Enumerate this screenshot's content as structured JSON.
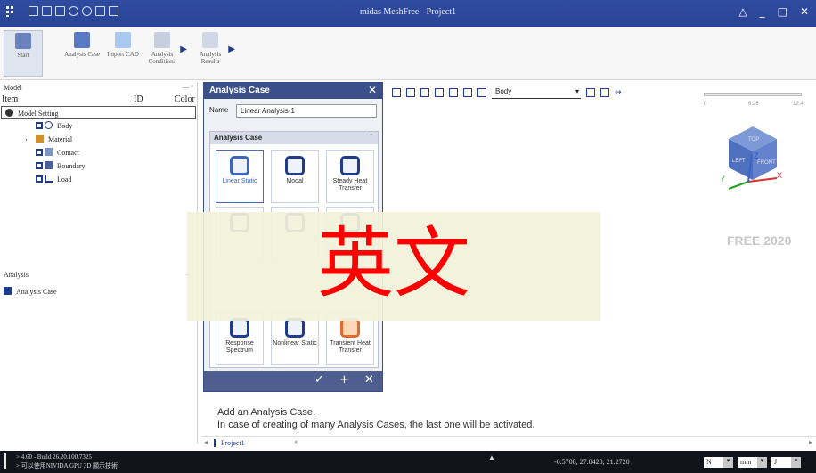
{
  "window": {
    "title": "midas MeshFree - Project1",
    "controls": [
      "△",
      "_",
      "□",
      "✕"
    ]
  },
  "ribbon": {
    "buttons": [
      {
        "id": "start",
        "label": "Start"
      },
      {
        "id": "analysis-case",
        "label": "Analysis Case"
      },
      {
        "id": "import-cad",
        "label": "Import CAD"
      },
      {
        "id": "analysis-conditions",
        "label": "Analysis Conditions"
      },
      {
        "id": "analysis-results",
        "label": "Analysis Results"
      }
    ]
  },
  "model_panel": {
    "title": "Model",
    "pin": "— ᵠ",
    "columns": {
      "item": "Item",
      "id": "ID",
      "color": "Color"
    },
    "items": [
      {
        "label": "Model Setting"
      },
      {
        "label": "Body"
      },
      {
        "label": "Material"
      },
      {
        "label": "Contact"
      },
      {
        "label": "Boundary"
      },
      {
        "label": "Load"
      }
    ]
  },
  "analysis_panel": {
    "title": "Analysis",
    "pin": "—",
    "items": [
      {
        "label": "Analysis Case"
      }
    ]
  },
  "dialog": {
    "title": "Analysis Case",
    "name_label": "Name",
    "name_value": "Linear Analysis-1",
    "group_title": "Analysis Case",
    "tiles": [
      {
        "label": "Linear Static"
      },
      {
        "label": "Modal"
      },
      {
        "label": "Steady Heat Transfer"
      },
      {
        "label": "Response Spectrum"
      },
      {
        "label": "Nonlinear Static"
      },
      {
        "label": "Transient Heat Transfer"
      }
    ],
    "footer": [
      "✓",
      "+",
      "✕"
    ]
  },
  "viewport": {
    "body_combo": "Body",
    "ruler": [
      "0",
      "6.26",
      "12.4"
    ],
    "cube_labels": {
      "top": "TOP",
      "left": "LEFT",
      "front": "FRONT",
      "x": "X",
      "y": "Y",
      "z": "Z"
    },
    "brand": "FREE 2020"
  },
  "overlay": {
    "text": "英文"
  },
  "help": {
    "line1": "Add an Analysis Case.",
    "line2": "In case of creating of many Analysis Cases, the last one will be activated."
  },
  "doc_tab": {
    "label": "Project1",
    "close": "×"
  },
  "status": {
    "line1": "> 4.60 - Build 26.20.100.7325",
    "line2": "> 可以使用NIVIDA GPU 3D 顯示技術",
    "coords": "-6.5708, 27.8428, 21.2720",
    "units": [
      "N",
      "mm",
      "J"
    ]
  }
}
